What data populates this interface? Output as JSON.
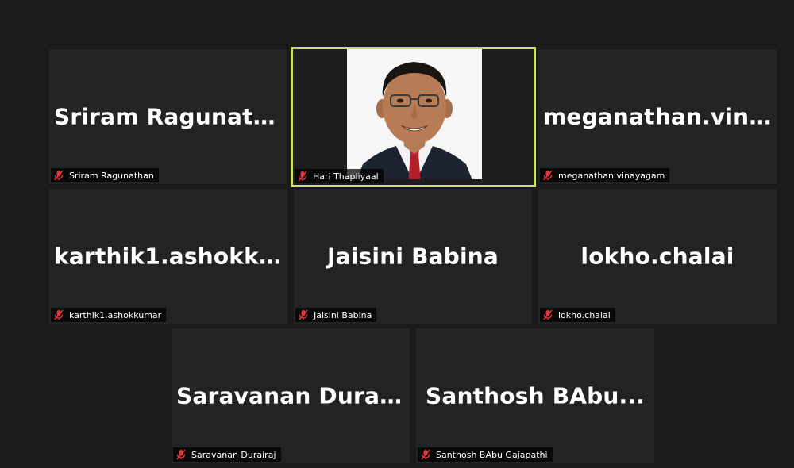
{
  "participants": [
    {
      "big": "Sriram  Ragunath...",
      "label": "Sriram Ragunathan",
      "muted": true
    },
    {
      "big": "",
      "label": "Hari Thapliyaal",
      "muted": true,
      "active": true,
      "video": true
    },
    {
      "big": "meganathan.vin...",
      "label": "meganathan.vinayagam",
      "muted": true
    },
    {
      "big": "karthik1.ashokk...",
      "label": "karthik1.ashokkumar",
      "muted": true
    },
    {
      "big": "Jaisini Babina",
      "label": "Jaisini Babina",
      "muted": true
    },
    {
      "big": "lokho.chalai",
      "label": "lokho.chalai",
      "muted": true
    },
    {
      "big": "Saravanan  Durai...",
      "label": "Saravanan Durairaj",
      "muted": true
    },
    {
      "big": "Santhosh  BAbu...",
      "label": "Santhosh BAbu Gajapathi",
      "muted": true
    }
  ],
  "colors": {
    "active_border": "#c9e265",
    "mute_icon": "#e0383e",
    "tile_bg": "#232323",
    "page_bg": "#1a1a1a"
  },
  "icons": {
    "mute": "mic-muted-icon"
  }
}
